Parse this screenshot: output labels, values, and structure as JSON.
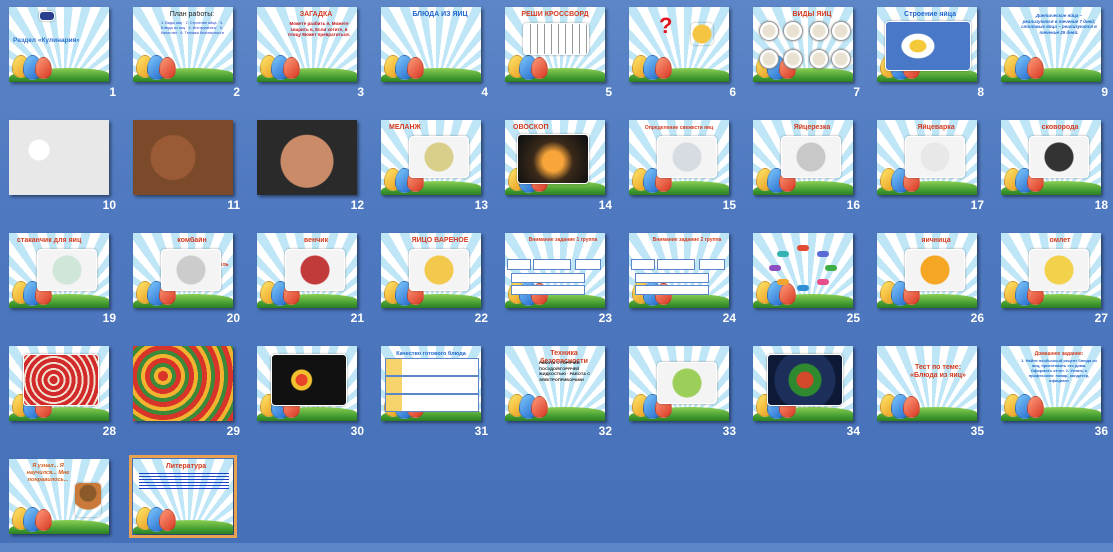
{
  "app": {
    "view": "slide-sorter"
  },
  "slides": [
    {
      "num": "1",
      "title": "Раздел «Кулинария»",
      "body": "",
      "kind": "title"
    },
    {
      "num": "2",
      "title": "План работы:",
      "body": "1. Виды яиц · 2. Строение яйца · 3. Блюда из яиц · 4. Инструменты · 5. Качество · 6. Техника безопасности",
      "kind": "plan"
    },
    {
      "num": "3",
      "title": "ЗАГАДКА",
      "body": "Можете разбить я, Можете сварить я, Если хотите, в птицу Может превратиться.",
      "kind": "text"
    },
    {
      "num": "4",
      "title": "БЛЮДА ИЗ ЯИЦ",
      "body": "",
      "kind": "text"
    },
    {
      "num": "5",
      "title": "РЕШИ КРОССВОРД",
      "body": "",
      "kind": "crossword"
    },
    {
      "num": "6",
      "title": "",
      "body": "",
      "kind": "question"
    },
    {
      "num": "7",
      "title": "ВИДЫ ЯИЦ",
      "body": "",
      "kind": "kinds"
    },
    {
      "num": "8",
      "title": "Строение яйца",
      "body": "",
      "kind": "structure"
    },
    {
      "num": "9",
      "title": "",
      "body": "Диетические яйца – реализуются в течение 7 дней; столовые яйца – реализуются в течение 25 дней.",
      "kind": "text"
    },
    {
      "num": "10",
      "title": "",
      "body": "",
      "kind": "photo-white-eggs"
    },
    {
      "num": "11",
      "title": "",
      "body": "",
      "kind": "photo-nest"
    },
    {
      "num": "12",
      "title": "",
      "body": "",
      "kind": "photo-brown"
    },
    {
      "num": "13",
      "title": "МЕЛАНЖ",
      "body": "",
      "kind": "pic"
    },
    {
      "num": "14",
      "title": "ОВОСКОП",
      "body": "",
      "kind": "ovoscope"
    },
    {
      "num": "15",
      "title": "Определение свежести яиц",
      "body": "",
      "kind": "pic"
    },
    {
      "num": "16",
      "title": "Яйцерезка",
      "body": "",
      "kind": "pic"
    },
    {
      "num": "17",
      "title": "Яйцеварка",
      "body": "",
      "kind": "pic"
    },
    {
      "num": "18",
      "title": "сковорода",
      "body": "",
      "kind": "pic"
    },
    {
      "num": "19",
      "title": "стаканчик для яиц",
      "body": "",
      "kind": "pic"
    },
    {
      "num": "20",
      "title": "комбайн",
      "body": "измельчитель",
      "kind": "pic"
    },
    {
      "num": "21",
      "title": "венчик",
      "body": "миксер",
      "kind": "pic"
    },
    {
      "num": "22",
      "title": "ЯЙЦО ВАРЕНОЕ",
      "body": "",
      "kind": "pic"
    },
    {
      "num": "23",
      "title": "Внимание задание 1 группа",
      "body": "",
      "kind": "scheme"
    },
    {
      "num": "24",
      "title": "Внимание задание 2 группа",
      "body": "",
      "kind": "scheme"
    },
    {
      "num": "25",
      "title": "",
      "body": "",
      "kind": "mindmap"
    },
    {
      "num": "26",
      "title": "яичница",
      "body": "",
      "kind": "pic"
    },
    {
      "num": "27",
      "title": "омлет",
      "body": "",
      "kind": "pic"
    },
    {
      "num": "28",
      "title": "",
      "body": "",
      "kind": "pic-easter"
    },
    {
      "num": "29",
      "title": "",
      "body": "",
      "kind": "photo-easter"
    },
    {
      "num": "30",
      "title": "",
      "body": "",
      "kind": "pic-dark"
    },
    {
      "num": "31",
      "title": "Качество готового блюда",
      "body": "",
      "kind": "table"
    },
    {
      "num": "32",
      "title": "Техника безопасности",
      "body": "РАБОТА С ГОРЯЧЕЙ ПОСУДОЙ/ГОРЯЧЕЙ ЖИДКОСТЬЮ · РАБОТА С ЭЛЕКТРОПРИБОРАМИ",
      "kind": "text"
    },
    {
      "num": "33",
      "title": "",
      "body": "",
      "kind": "pic"
    },
    {
      "num": "34",
      "title": "",
      "body": "",
      "kind": "pic-plate"
    },
    {
      "num": "35",
      "title": "Тест по теме: «Блюда из яиц»",
      "body": "",
      "kind": "text"
    },
    {
      "num": "36",
      "title": "Домашнее задание:",
      "body": "1. Найти необычный рецепт блюда из яиц, приготовить его дома. Оформить отчет. 2. Узнать о профессиях: повар, кондитер, официант",
      "kind": "text"
    },
    {
      "num": "",
      "title": "Я узнал... Я научился... Мне понравилось...",
      "body": "",
      "kind": "reflection"
    },
    {
      "num": "",
      "title": "Литература",
      "body": "",
      "kind": "literature",
      "selected": true
    }
  ]
}
